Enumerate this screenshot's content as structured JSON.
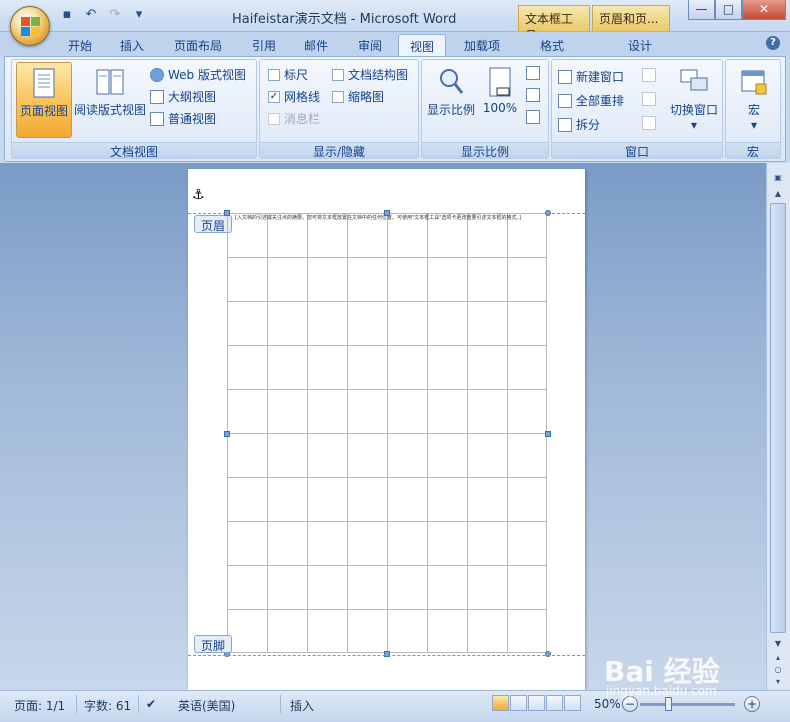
{
  "window": {
    "title": "Haifeistar演示文档 - Microsoft Word",
    "context_tabs": [
      "文本框工具",
      "页眉和页..."
    ],
    "min": "—",
    "max": "□",
    "close": "✕"
  },
  "tabs": [
    {
      "label": "开始"
    },
    {
      "label": "插入"
    },
    {
      "label": "页面布局"
    },
    {
      "label": "引用"
    },
    {
      "label": "邮件"
    },
    {
      "label": "审阅"
    },
    {
      "label": "视图"
    },
    {
      "label": "加载项"
    },
    {
      "label": "格式"
    },
    {
      "label": "设计"
    }
  ],
  "ribbon": {
    "doc_views": {
      "label": "文档视图",
      "print_layout": "页面视图",
      "full_reading": "阅读版式视图",
      "web_layout": "Web 版式视图",
      "outline": "大纲视图",
      "draft": "普通视图"
    },
    "show_hide": {
      "label": "显示/隐藏",
      "ruler": "标尺",
      "gridlines": "网格线",
      "message_bar": "消息栏",
      "doc_map": "文档结构图",
      "thumbnails": "缩略图",
      "gridlines_check": "✓"
    },
    "zoom": {
      "label": "显示比例",
      "zoom_btn": "显示比例",
      "hundred": "100%",
      "page_icon_text": "100"
    },
    "window": {
      "label": "窗口",
      "new_window": "新建窗口",
      "arrange_all": "全部重排",
      "split": "拆分",
      "switch_windows": "切换窗口",
      "dropdown": "▾"
    },
    "macros": {
      "label": "宏",
      "macros_btn": "宏",
      "dropdown": "▾"
    }
  },
  "document": {
    "header_label": "页眉",
    "footer_label": "页脚",
    "header_text": "[入文档的引述或关注点的摘要。您可将文本框放置在文档中的任何位置。可使用\"文本框工具\"选项卡更改重要引述文本框的格式。]",
    "anchor": "⚓"
  },
  "statusbar": {
    "page": "页面: 1/1",
    "words": "字数: 61",
    "language": "英语(美国)",
    "mode": "插入",
    "zoom": "50%",
    "minus": "−",
    "plus": "+"
  },
  "watermark": {
    "brand": "Bai 经验",
    "url": "jingyan.baidu.com"
  }
}
